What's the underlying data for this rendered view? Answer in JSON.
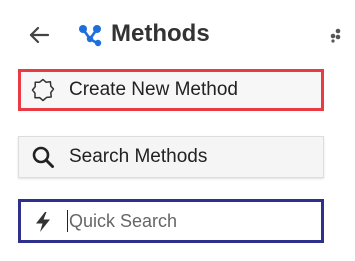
{
  "header": {
    "title": "Methods",
    "back_icon": "arrow-left-icon",
    "brand_icon": "molecule-icon",
    "menu_icon": "drag-dots-icon"
  },
  "actions": {
    "create": {
      "label": "Create New Method",
      "icon": "gear-outline-icon"
    },
    "search": {
      "label": "Search Methods",
      "icon": "search-icon"
    }
  },
  "quick_search": {
    "placeholder": "Quick Search",
    "value": "",
    "icon": "lightning-icon"
  },
  "colors": {
    "title": "#333333",
    "brand": "#1e6fd9",
    "create_border": "#ea3b45",
    "quick_border": "#2f2f8c",
    "button_bg": "#f5f5f5"
  }
}
